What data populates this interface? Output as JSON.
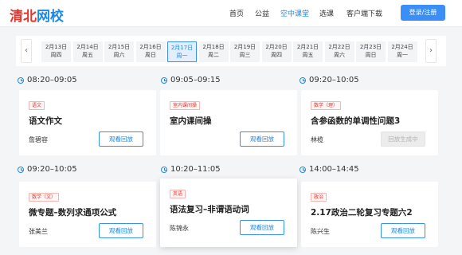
{
  "header": {
    "logo_part1": "清北",
    "logo_part2": "网校",
    "nav": [
      "首页",
      "公益",
      "空中课堂",
      "选课",
      "客户端下载"
    ],
    "active_nav": "空中课堂",
    "login_label": "登录/注册"
  },
  "datebar": {
    "prev_icon": "‹",
    "next_icon": "›",
    "dates": [
      {
        "date": "2月13日",
        "weekday": "周四"
      },
      {
        "date": "2月14日",
        "weekday": "周五"
      },
      {
        "date": "2月15日",
        "weekday": "周六"
      },
      {
        "date": "2月16日",
        "weekday": "周日"
      },
      {
        "date": "2月17日",
        "weekday": "周一",
        "active": true
      },
      {
        "date": "2月18日",
        "weekday": "周二"
      },
      {
        "date": "2月19日",
        "weekday": "周三"
      },
      {
        "date": "2月20日",
        "weekday": "周四"
      },
      {
        "date": "2月21日",
        "weekday": "周五"
      },
      {
        "date": "2月22日",
        "weekday": "周六"
      },
      {
        "date": "2月23日",
        "weekday": "周日"
      },
      {
        "date": "2月24日",
        "weekday": "周一"
      }
    ]
  },
  "courses": [
    {
      "time": "08:20–09:05",
      "tag": "语文",
      "title": "语文作文",
      "teacher": "詹碧容",
      "button": "观看回放",
      "disabled": false
    },
    {
      "time": "09:05–09:15",
      "tag": "室内课间操",
      "title": "室内课间操",
      "teacher": "",
      "button": "观看回放",
      "disabled": false
    },
    {
      "time": "09:20–10:05",
      "tag": "数学（理）",
      "title": "含参函数的单调性问题3",
      "teacher": "林榄",
      "button": "回放生成中",
      "disabled": true
    },
    {
      "time": "09:20–10:05",
      "tag": "数学（文）",
      "title": "微专题–数列求通项公式",
      "teacher": "张美兰",
      "button": "观看回放",
      "disabled": false
    },
    {
      "time": "10:20–11:05",
      "tag": "英语",
      "title": "语法复习–非谓语动词",
      "teacher": "陈锦永",
      "button": "观看回放",
      "disabled": false
    },
    {
      "time": "14:00–14:45",
      "tag": "政治",
      "title": "2.17政治二轮复习专题六2",
      "teacher": "陈兴生",
      "button": "观看回放",
      "disabled": false
    }
  ],
  "colors": {
    "accent": "#3a8ef6",
    "brand_red": "#e8332c",
    "tag_red": "#e8332c"
  }
}
